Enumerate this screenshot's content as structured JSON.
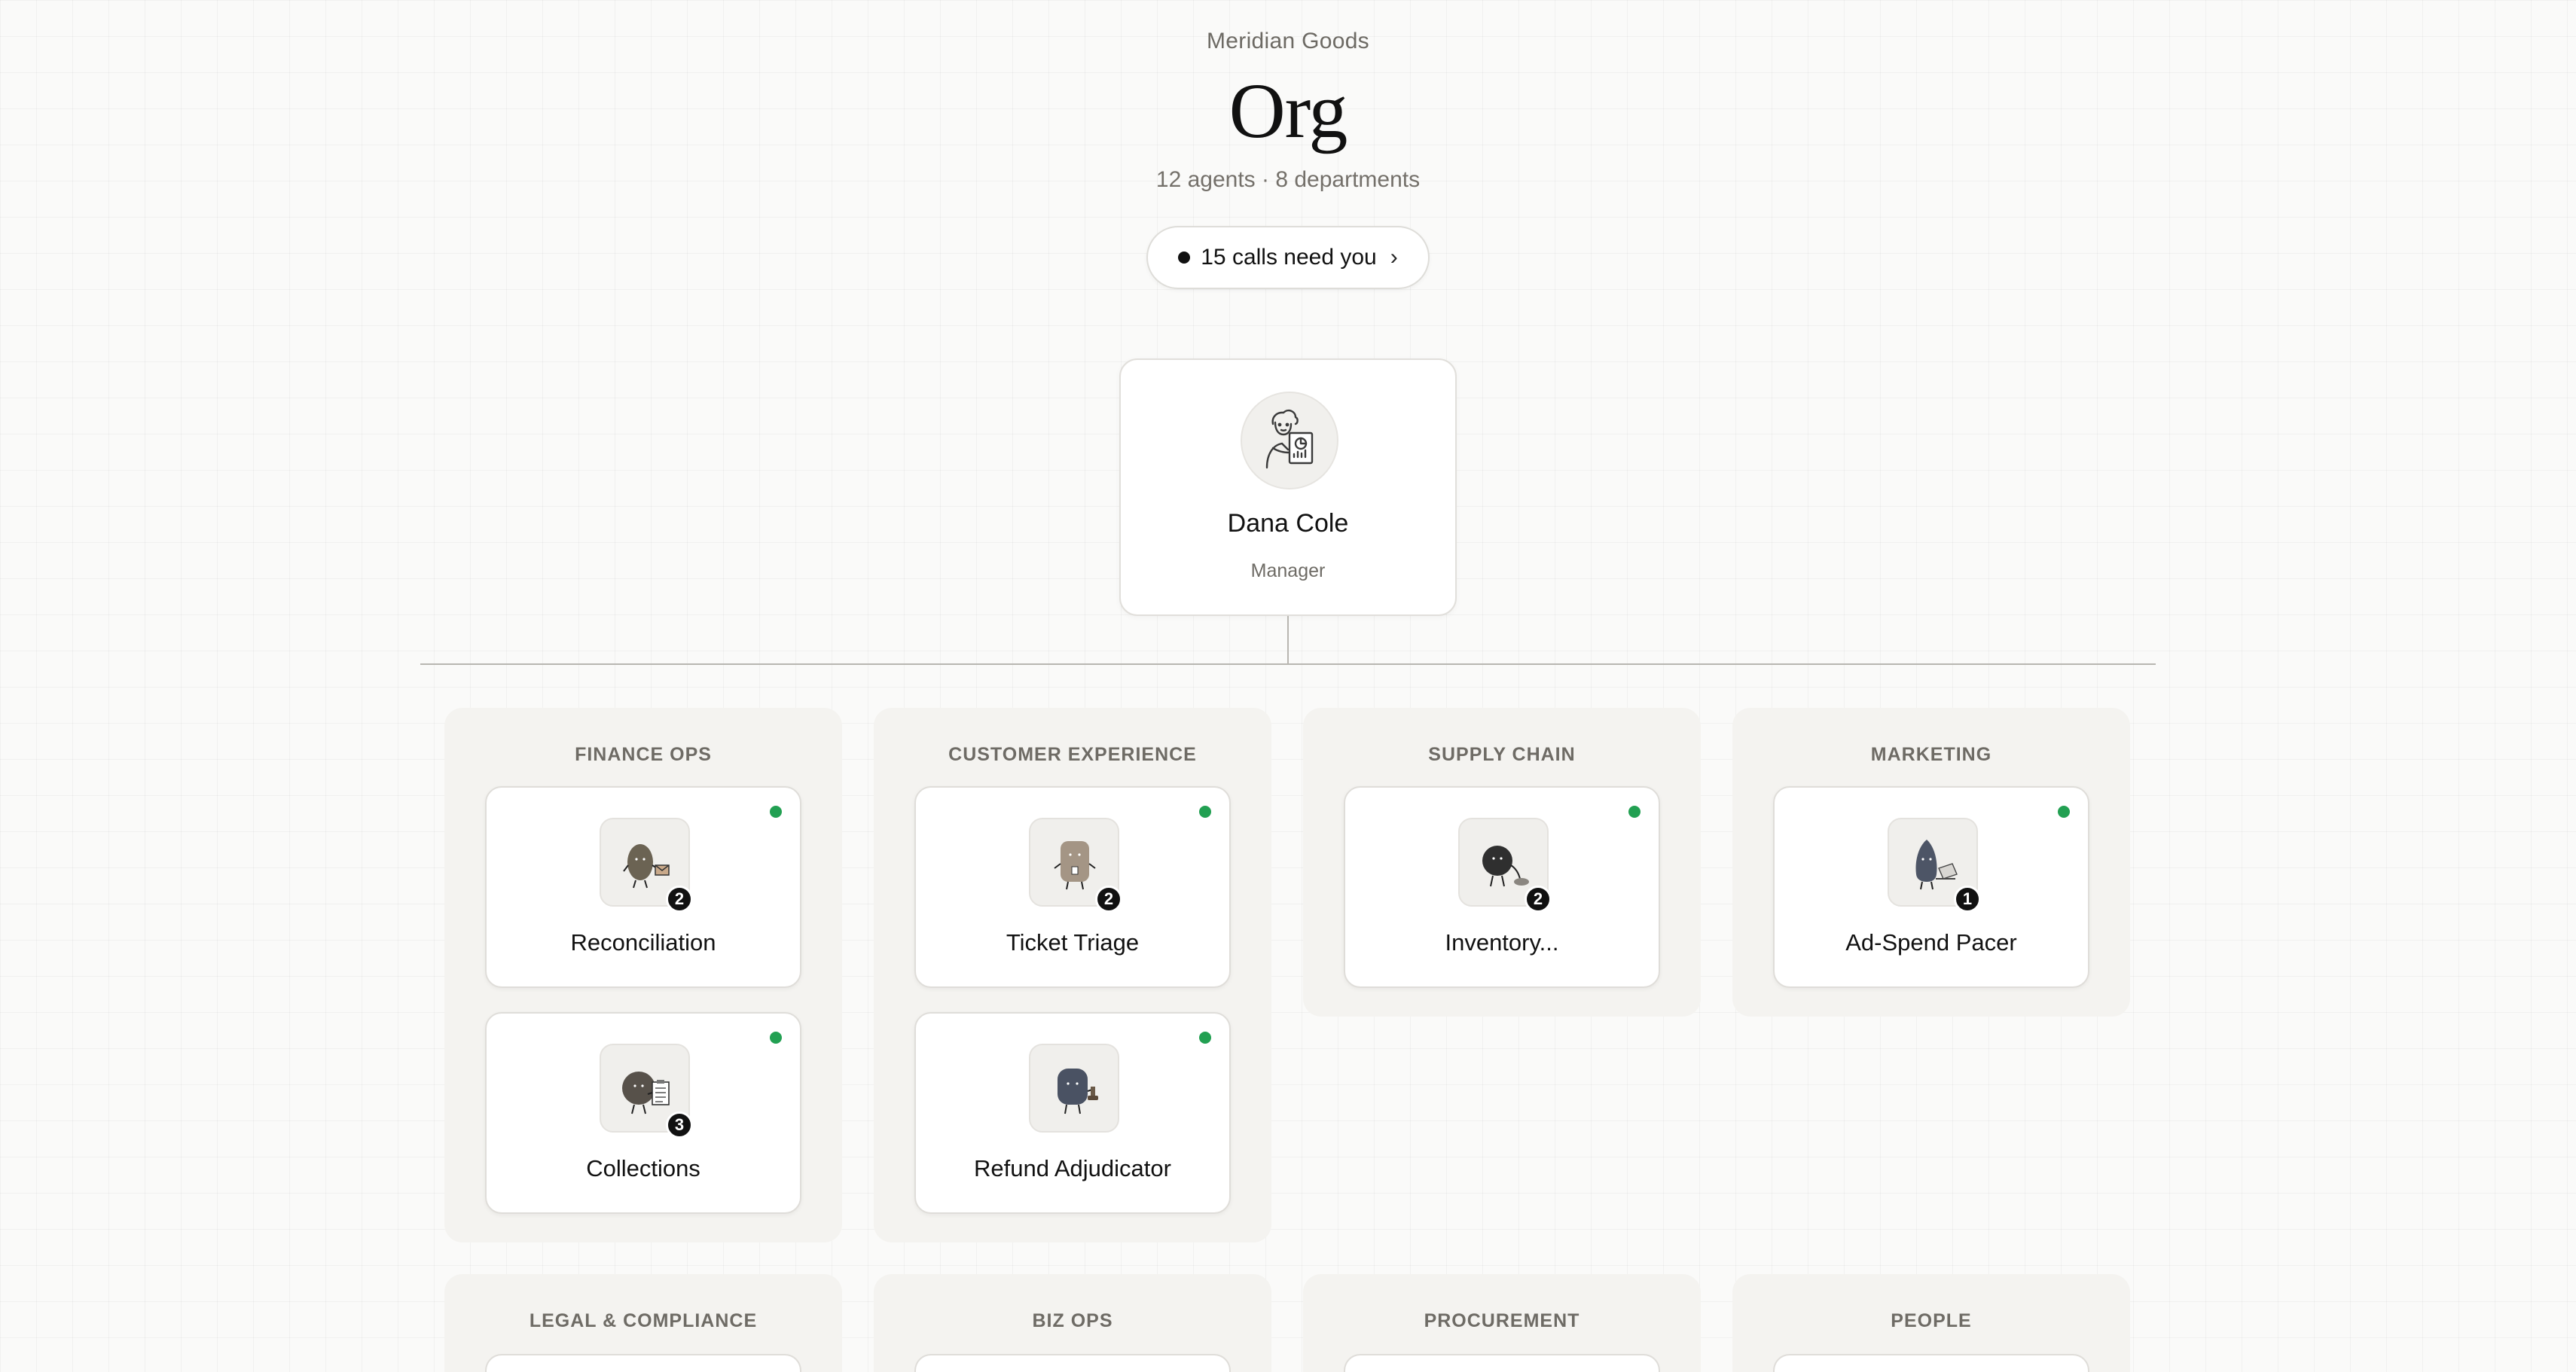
{
  "header": {
    "org_name": "Meridian Goods",
    "title": "Org",
    "summary": "12 agents · 8 departments",
    "calls_label": "15 calls need you"
  },
  "manager": {
    "name": "Dana Cole",
    "role": "Manager"
  },
  "colors": {
    "status_active": "#22a052",
    "badge": "#111111"
  },
  "departments": [
    {
      "title": "FINANCE OPS",
      "agents": [
        {
          "name": "Reconciliation",
          "badge": "2",
          "status": "active",
          "icon": "envelope-agent-icon"
        },
        {
          "name": "Collections",
          "badge": "3",
          "status": "active",
          "icon": "clipboard-agent-icon"
        }
      ]
    },
    {
      "title": "CUSTOMER EXPERIENCE",
      "agents": [
        {
          "name": "Ticket Triage",
          "badge": "2",
          "status": "active",
          "icon": "badge-agent-icon"
        },
        {
          "name": "Refund Adjudicator",
          "badge": "",
          "status": "active",
          "icon": "stamp-agent-icon"
        }
      ]
    },
    {
      "title": "SUPPLY CHAIN",
      "agents": [
        {
          "name": "Inventory...",
          "badge": "2",
          "status": "active",
          "icon": "box-agent-icon"
        }
      ]
    },
    {
      "title": "MARKETING",
      "agents": [
        {
          "name": "Ad-Spend Pacer",
          "badge": "1",
          "status": "active",
          "icon": "laptop-agent-icon"
        }
      ]
    },
    {
      "title": "LEGAL & COMPLIANCE",
      "agents": []
    },
    {
      "title": "BIZ OPS",
      "agents": []
    },
    {
      "title": "PROCUREMENT",
      "agents": []
    },
    {
      "title": "PEOPLE",
      "agents": []
    }
  ]
}
